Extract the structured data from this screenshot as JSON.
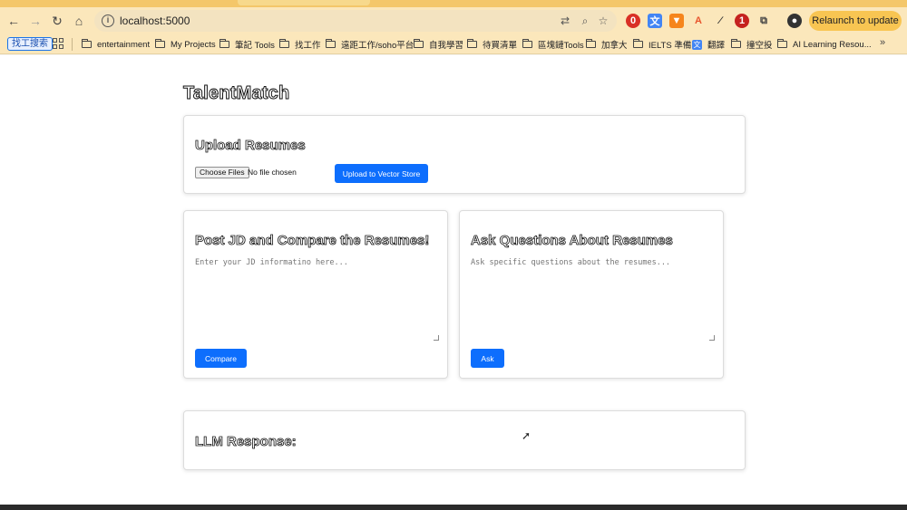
{
  "browser": {
    "url": "localhost:5000",
    "relaunch_label": "Relaunch to update",
    "bookmarks": [
      {
        "label": "找工搜索",
        "kind": "button"
      },
      {
        "label": "entertainment",
        "kind": "folder"
      },
      {
        "label": "My Projects",
        "kind": "folder"
      },
      {
        "label": "筆記 Tools",
        "kind": "folder"
      },
      {
        "label": "找工作",
        "kind": "folder"
      },
      {
        "label": "遠距工作/soho平台",
        "kind": "folder"
      },
      {
        "label": "自我學習",
        "kind": "folder"
      },
      {
        "label": "待買清單",
        "kind": "folder"
      },
      {
        "label": "區塊鏈Tools",
        "kind": "folder"
      },
      {
        "label": "加拿大",
        "kind": "folder"
      },
      {
        "label": "IELTS 準備",
        "kind": "folder"
      },
      {
        "label": "翻譯",
        "kind": "link"
      },
      {
        "label": "撞空投",
        "kind": "folder"
      },
      {
        "label": "AI Learning Resou...",
        "kind": "folder"
      }
    ],
    "more_label": "»",
    "ext_badge": "1"
  },
  "page": {
    "title": "TalentMatch",
    "upload": {
      "heading": "Upload Resumes",
      "choose_files": "Choose Files",
      "no_file": "No file chosen",
      "upload_button": "Upload to Vector Store"
    },
    "compare": {
      "heading": "Post JD and Compare the Resumes!",
      "placeholder": "Enter your JD informatino here...",
      "button": "Compare"
    },
    "ask": {
      "heading": "Ask Questions About Resumes",
      "placeholder": "Ask specific questions about the resumes...",
      "button": "Ask"
    },
    "response": {
      "heading": "LLM Response:"
    }
  },
  "colors": {
    "primary": "#0d6efd",
    "chrome_bar": "#fbe7bb",
    "relaunch": "#f8c552"
  }
}
